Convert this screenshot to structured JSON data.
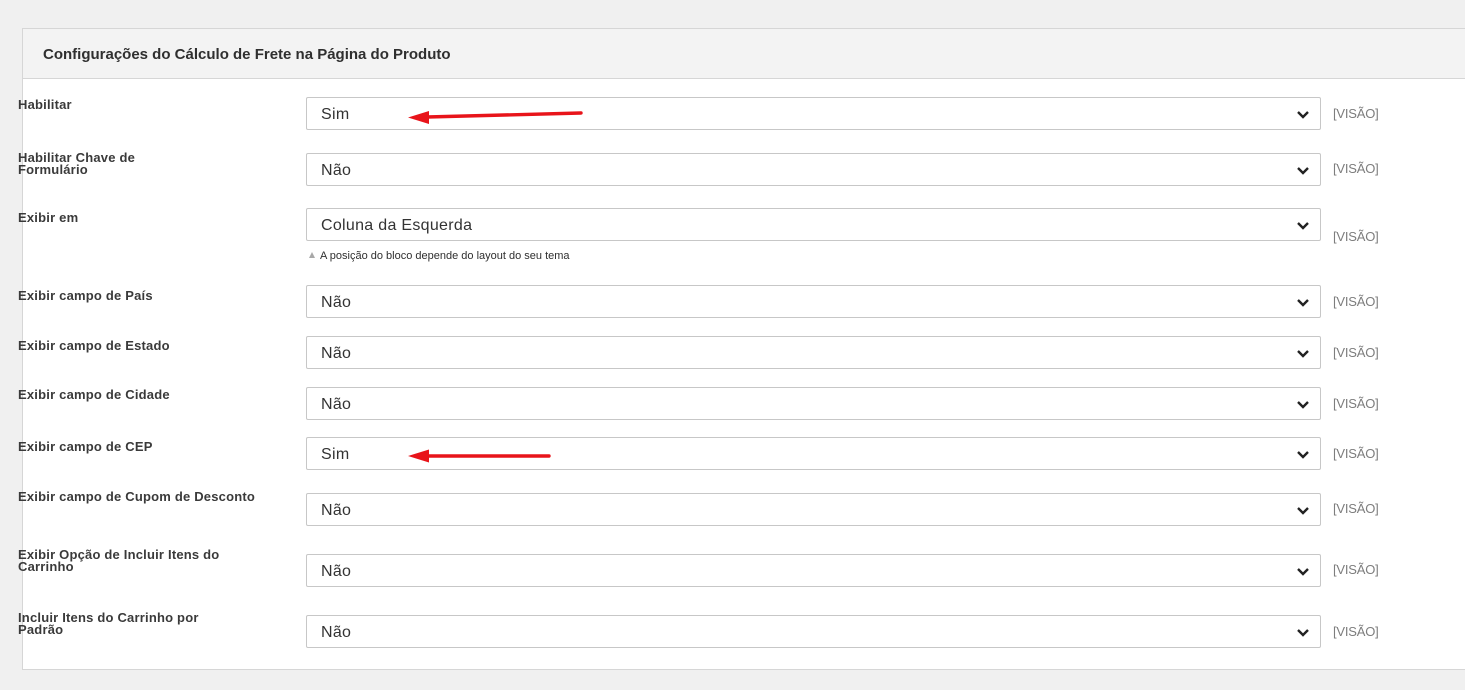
{
  "section": {
    "title": "Configurações do Cálculo de Frete na Página do Produto"
  },
  "fields": [
    {
      "label": "Habilitar",
      "value": "Sim",
      "scope": "[VISÃO]"
    },
    {
      "label": "Habilitar Chave de Formulário",
      "value": "Não",
      "scope": "[VISÃO]"
    },
    {
      "label": "Exibir em",
      "value": "Coluna da Esquerda",
      "scope": "[VISÃO]",
      "note": "A posição do bloco depende do layout do seu tema"
    },
    {
      "label": "Exibir campo de País",
      "value": "Não",
      "scope": "[VISÃO]"
    },
    {
      "label": "Exibir campo de Estado",
      "value": "Não",
      "scope": "[VISÃO]"
    },
    {
      "label": "Exibir campo de Cidade",
      "value": "Não",
      "scope": "[VISÃO]"
    },
    {
      "label": "Exibir campo de CEP",
      "value": "Sim",
      "scope": "[VISÃO]"
    },
    {
      "label": "Exibir campo de Cupom de Desconto",
      "value": "Não",
      "scope": "[VISÃO]"
    },
    {
      "label": "Exibir Opção de Incluir Itens do Carrinho",
      "value": "Não",
      "scope": "[VISÃO]"
    },
    {
      "label": "Incluir Itens do Carrinho por Padrão",
      "value": "Não",
      "scope": "[VISÃO]"
    }
  ],
  "icons": {
    "select_chevron": "chevron-down-icon",
    "note_marker": "triangle-up-icon",
    "annotation": "red-arrow-icon"
  },
  "colors": {
    "annotation_arrow": "#e8141a",
    "label_text": "#3a3a3a",
    "scope_text": "#7d7d7d",
    "header_background": "#f3f3f3"
  }
}
